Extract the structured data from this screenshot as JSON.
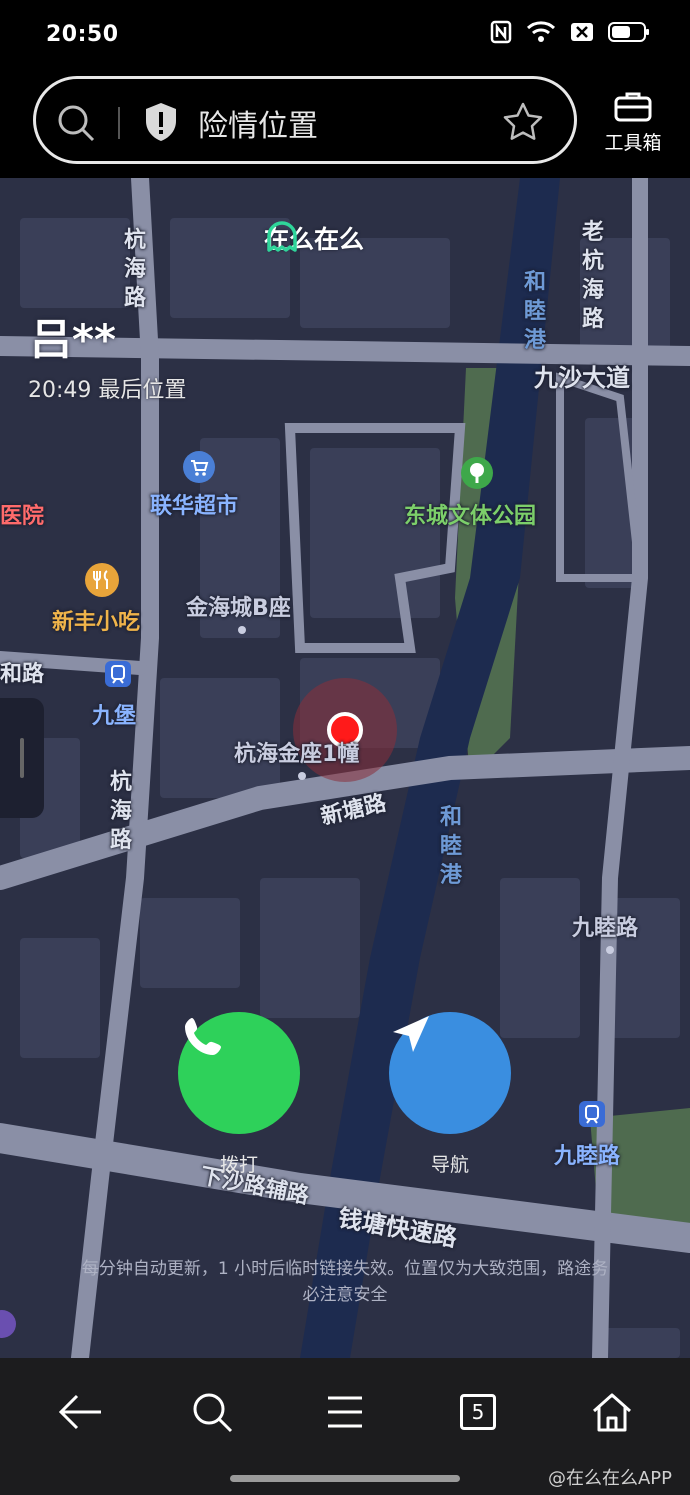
{
  "status_bar": {
    "time": "20:50"
  },
  "search": {
    "text": "险情位置"
  },
  "toolbox": {
    "label": "工具箱"
  },
  "brand": {
    "name": "在么在么",
    "accent": "#2fd59a"
  },
  "person": {
    "name": "吕**",
    "last_seen": "20:49 最后位置"
  },
  "map": {
    "roads": [
      {
        "id": "road-hanghai-1",
        "text": "杭海路"
      },
      {
        "id": "road-laohanghai",
        "text": "老杭海路"
      },
      {
        "id": "road-jiusha",
        "text": "九沙大道"
      },
      {
        "id": "river-hemu-1",
        "text": "和睦港"
      },
      {
        "id": "road-xintang",
        "text": "新塘路"
      },
      {
        "id": "river-hemu-2",
        "text": "和睦港"
      },
      {
        "id": "road-hanghai-2",
        "text": "杭海路"
      },
      {
        "id": "road-xiasha",
        "text": "下沙路辅路"
      },
      {
        "id": "road-qiantang",
        "text": "钱塘快速路"
      },
      {
        "id": "road-he-partial",
        "text": "和路"
      }
    ],
    "pois": [
      {
        "id": "poi-lianhua",
        "text": "联华超市",
        "icon": "shopping-cart-icon"
      },
      {
        "id": "poi-dongcheng",
        "text": "东城文体公园",
        "icon": "tree-icon"
      },
      {
        "id": "poi-xinfeng",
        "text": "新丰小吃",
        "icon": "restaurant-icon"
      },
      {
        "id": "poi-jinhai",
        "text": "金海城B座",
        "icon": "dot-icon"
      },
      {
        "id": "poi-hospital",
        "text": "医院",
        "icon": "none"
      },
      {
        "id": "poi-jiubao",
        "text": "九堡",
        "icon": "metro-icon"
      },
      {
        "id": "poi-hanghaijin",
        "text": "杭海金座1幢",
        "icon": "dot-icon"
      },
      {
        "id": "poi-jiumulu",
        "text": "九睦路",
        "icon": "dot-icon"
      },
      {
        "id": "poi-jiumulu-metro",
        "text": "九睦路",
        "icon": "metro-icon"
      }
    ]
  },
  "actions": {
    "call_label": "拨打",
    "navigate_label": "导航",
    "call_color": "#2ed15a",
    "navigate_color": "#3a8ee0"
  },
  "notice": "每分钟自动更新，1 小时后临时链接失效。位置仅为大致范围，路途务必注意安全",
  "bottom_nav": {
    "tab_count": "5"
  },
  "watermark": "@在么在么APP"
}
